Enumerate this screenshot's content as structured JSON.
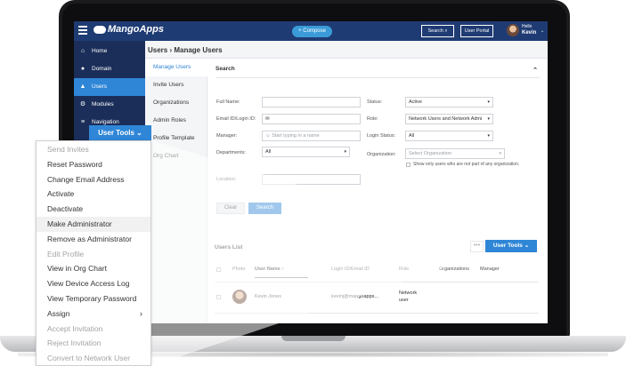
{
  "app": {
    "logo_text": "MangoApps",
    "compose_label": "+ Compose",
    "search_label": "Search",
    "user_portal_label": "User Portal",
    "hello_label": "Hello",
    "user_name": "Kevin"
  },
  "sidebar": {
    "items": [
      {
        "label": "Home",
        "icon": "home-icon"
      },
      {
        "label": "Domain",
        "icon": "globe-icon"
      },
      {
        "label": "Users",
        "icon": "user-icon",
        "active": true
      },
      {
        "label": "Modules",
        "icon": "modules-icon"
      },
      {
        "label": "Navigation",
        "icon": "list-icon"
      }
    ]
  },
  "page": {
    "breadcrumb": "Users › Manage Users"
  },
  "subnav": {
    "items": [
      "Manage Users",
      "Invite Users",
      "Organizations",
      "Admin Roles",
      "Profile Template",
      "Org Chart"
    ]
  },
  "search": {
    "title": "Search",
    "full_name_label": "Full Name:",
    "email_label": "Email ID/Login ID:",
    "manager_label": "Manager:",
    "manager_placeholder": "Start typing in a name",
    "departments_label": "Departments:",
    "departments_value": "All",
    "location_label": "Location:",
    "status_label": "Status:",
    "status_value": "Active",
    "role_label": "Role:",
    "role_value": "Network Users and Network Admi",
    "login_status_label": "Login Status:",
    "login_status_value": "All",
    "organization_label": "Organization:",
    "organization_placeholder": "Select Organization",
    "org_checkbox_label": "Show only users who are not part of any organization.",
    "clear_label": "Clear",
    "search_button_label": "Search"
  },
  "users_list": {
    "title": "Users List",
    "more_label": "•••",
    "user_tools_label": "User Tools ⌄",
    "columns": [
      "Photo",
      "User Name ↑",
      "Login ID/Email ID",
      "Role",
      "Organizations",
      "Manager"
    ],
    "rows": [
      {
        "name": "Kevin Jones",
        "email": "kevinj@mangoapps...",
        "role": "Network user"
      }
    ]
  },
  "dropdown": {
    "button_label": "User Tools ⌄",
    "items": [
      {
        "label": "Send Invites",
        "disabled": true
      },
      {
        "label": "Reset Password",
        "disabled": false
      },
      {
        "label": "Change Email Address",
        "disabled": false
      },
      {
        "label": "Activate",
        "disabled": false
      },
      {
        "label": "Deactivate",
        "disabled": false
      },
      {
        "label": "Make Administrator",
        "disabled": false,
        "highlighted": true
      },
      {
        "label": "Remove as Administrator",
        "disabled": false
      },
      {
        "label": "Edit Profile",
        "disabled": true
      },
      {
        "label": "View in Org Chart",
        "disabled": false
      },
      {
        "label": "View Device Access Log",
        "disabled": false
      },
      {
        "label": "View Temporary Password",
        "disabled": false
      },
      {
        "label": "Assign",
        "disabled": false,
        "submenu": true
      },
      {
        "label": "Accept Invitation",
        "disabled": true
      },
      {
        "label": "Reject Invitation",
        "disabled": true
      },
      {
        "label": "Convert to Network User",
        "disabled": true
      }
    ]
  },
  "colors": {
    "topbar": "#1f3b73",
    "sidebar": "#1b2e5a",
    "accent": "#2f86d6"
  }
}
